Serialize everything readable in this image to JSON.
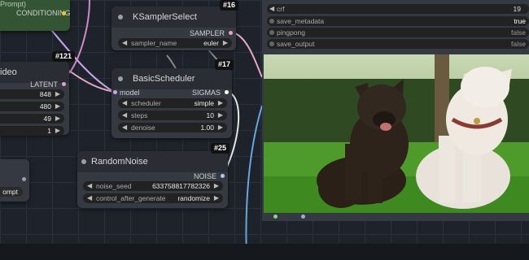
{
  "nodes": {
    "conditioning_node": {
      "output_label": "CONDITIONING",
      "top_text": "Prompt)"
    },
    "sampler_select": {
      "badge": "#16",
      "title": "KSamplerSelect",
      "output": "SAMPLER",
      "widget": {
        "name": "sampler_name",
        "value": "euler"
      }
    },
    "video_node": {
      "badge": "#121",
      "title": "ideo",
      "output": "LATENT",
      "values": [
        "848",
        "480",
        "49",
        "1"
      ]
    },
    "basic_scheduler": {
      "badge": "#17",
      "title": "BasicScheduler",
      "input": "model",
      "output": "SIGMAS",
      "widgets": [
        {
          "name": "scheduler",
          "value": "simple"
        },
        {
          "name": "steps",
          "value": "10"
        },
        {
          "name": "denoise",
          "value": "1.00"
        }
      ]
    },
    "random_noise": {
      "badge": "#25",
      "title": "RandomNoise",
      "output": "NOISE",
      "widgets": [
        {
          "name": "noise_seed",
          "value": "633758817782326"
        },
        {
          "name": "control_after_generate",
          "value": "randomize"
        }
      ]
    },
    "prompt_node": {
      "button": "ompt"
    }
  },
  "video_combine": {
    "rows": [
      {
        "name": "crf",
        "value": "19"
      },
      {
        "name": "save_metadata",
        "value": "true"
      },
      {
        "name": "pingpong",
        "value": "false"
      },
      {
        "name": "save_output",
        "value": "false"
      }
    ]
  },
  "colors": {
    "conditioning": "#f7c12b",
    "latent": "#e0a2d8",
    "sampler": "#f0a0c0",
    "sigmas": "#ffffff",
    "noise": "#b0c8e8",
    "model_link": "#c8a6e8",
    "blue_link": "#6aa6dc"
  }
}
